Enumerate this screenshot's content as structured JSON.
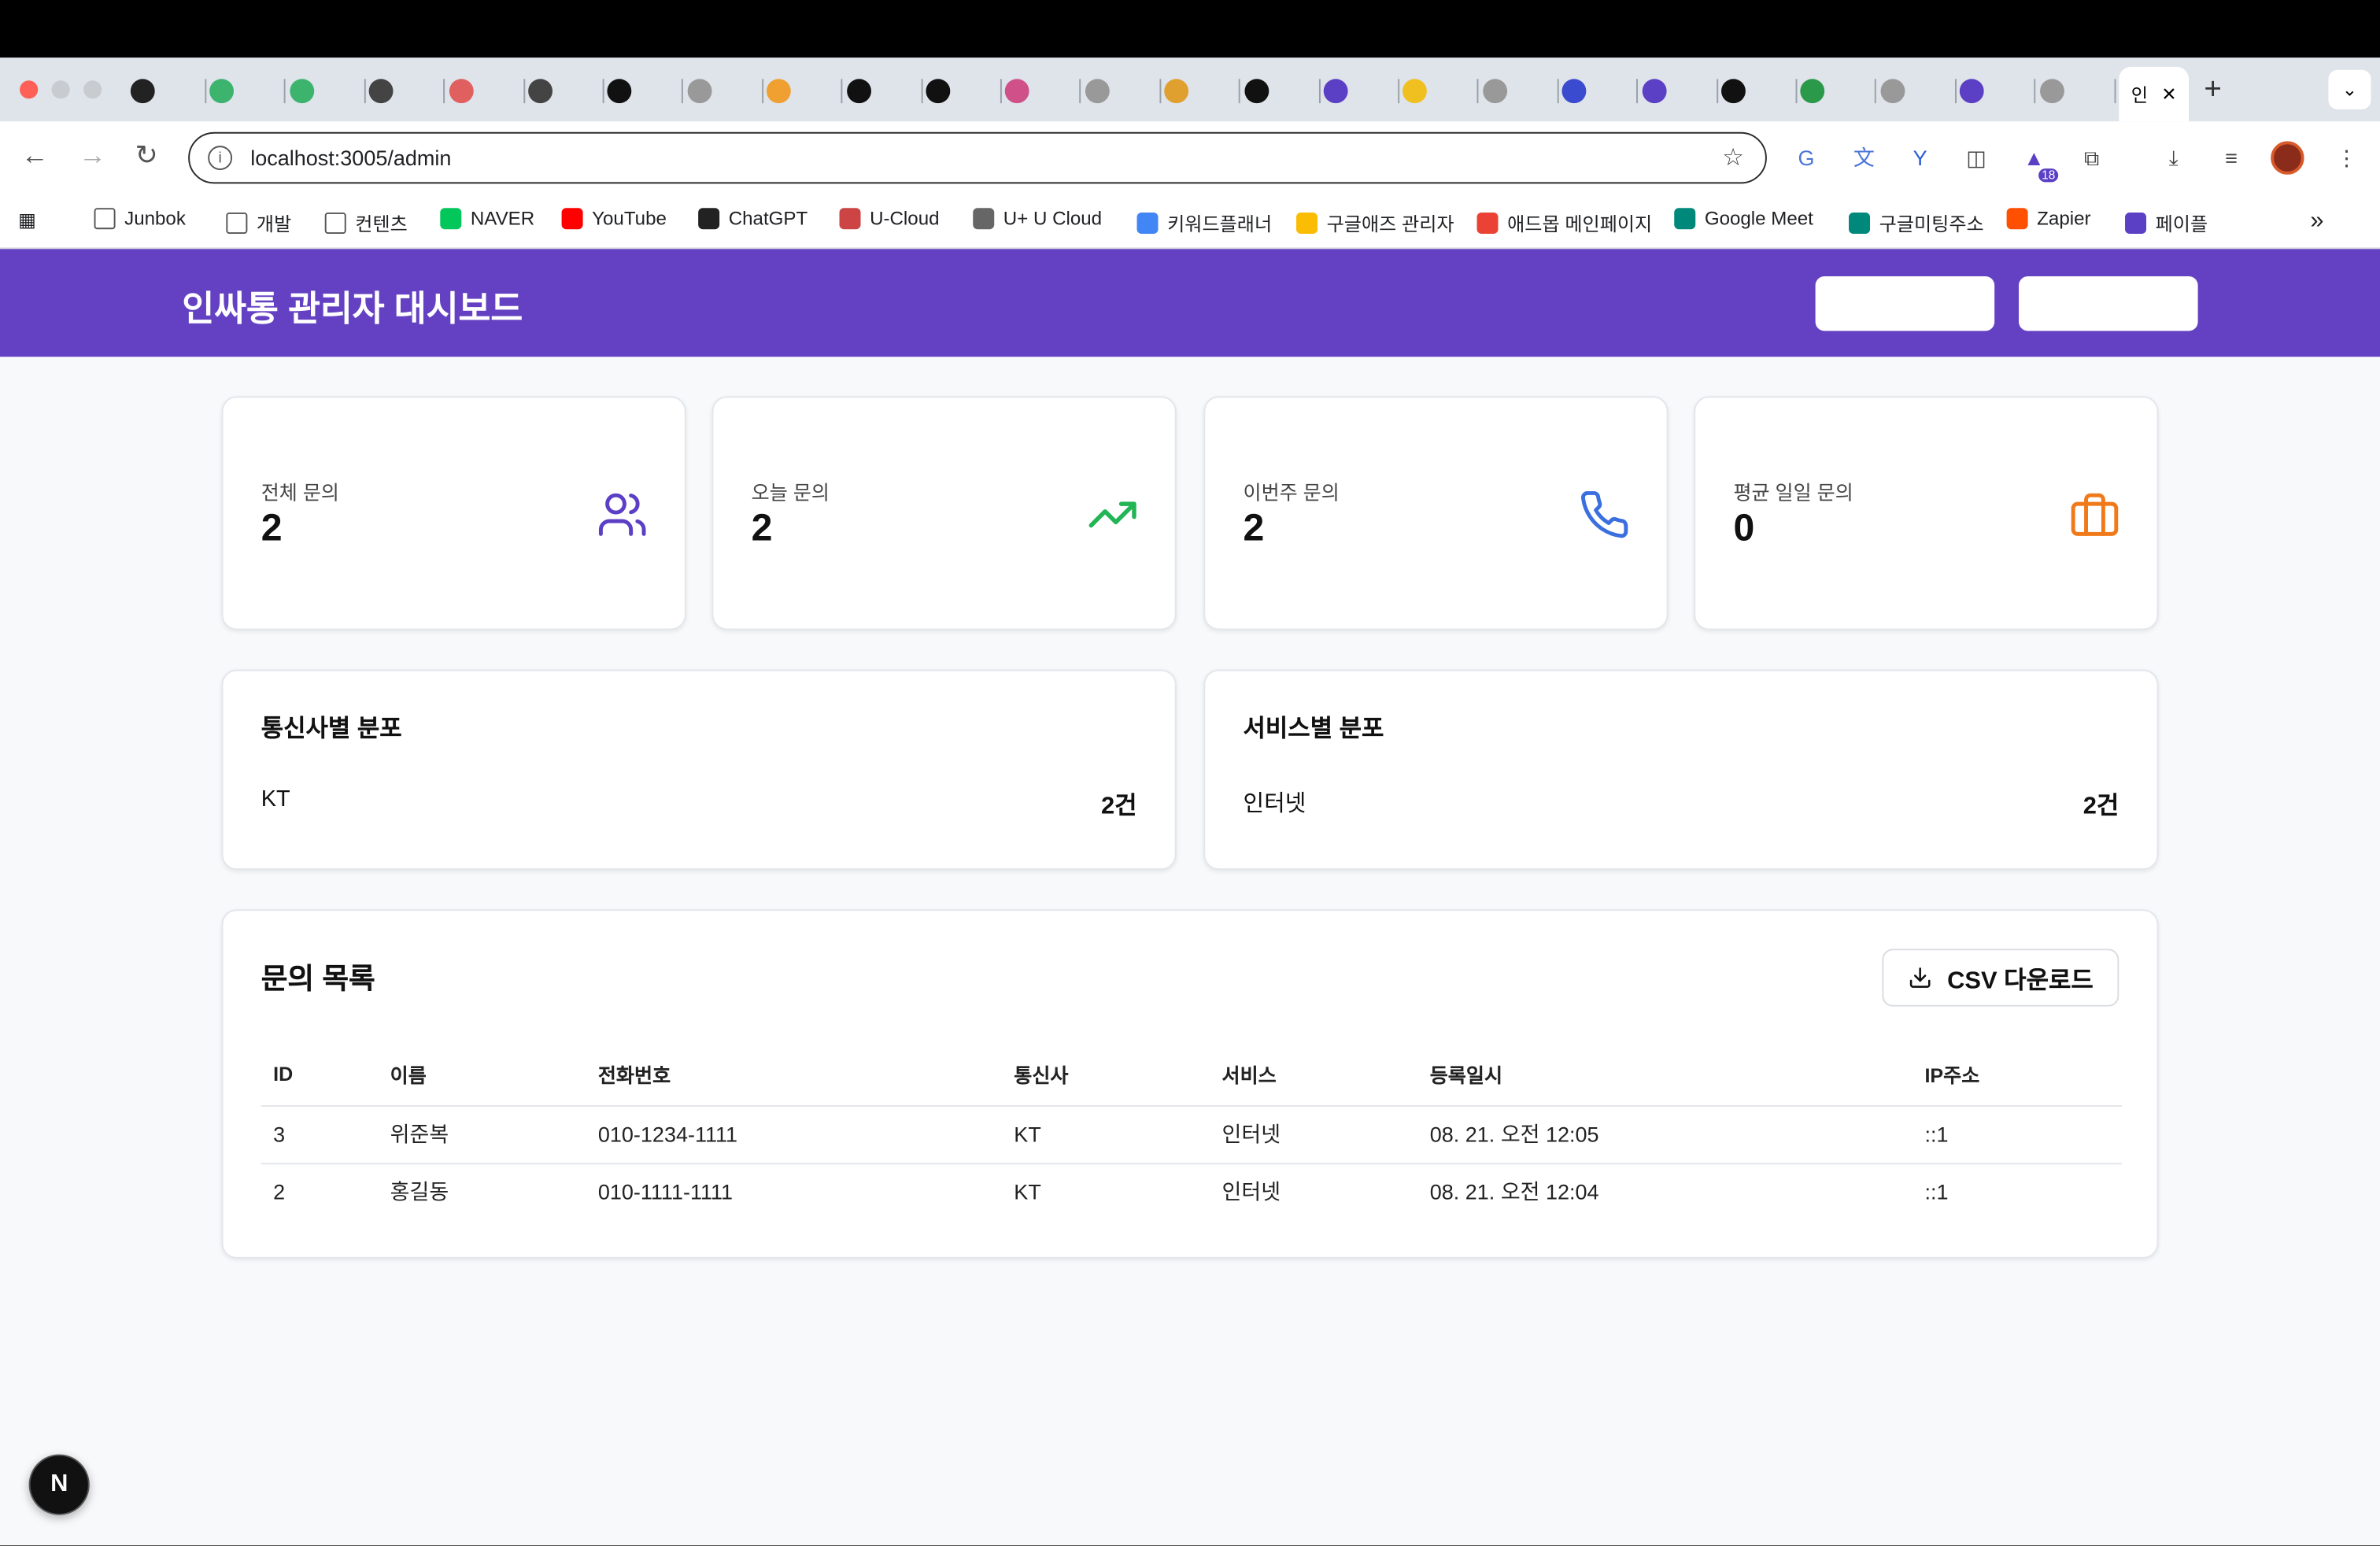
{
  "browser": {
    "url": "localhost:3005/admin",
    "active_tab_label": "인",
    "bookmarks": [
      "Junbok",
      "개발",
      "컨텐츠",
      "NAVER",
      "YouTube",
      "ChatGPT",
      "U-Cloud",
      "U+ U Cloud",
      "키워드플래너",
      "구글애즈 관리자",
      "애드몹 메인페이지",
      "Google Meet",
      "구글미팅주소",
      "Zapier",
      "페이플"
    ],
    "extension_badge": "18",
    "overflow_label": "»"
  },
  "header": {
    "title": "인싸통 관리자 대시보드"
  },
  "stats": [
    {
      "label": "전체 문의",
      "value": "2",
      "icon": "users-icon",
      "color": "#5b3fc4"
    },
    {
      "label": "오늘 문의",
      "value": "2",
      "icon": "trending-up-icon",
      "color": "#22b455"
    },
    {
      "label": "이번주 문의",
      "value": "2",
      "icon": "phone-icon",
      "color": "#3b6fe0"
    },
    {
      "label": "평균 일일 문의",
      "value": "0",
      "icon": "briefcase-icon",
      "color": "#f07a1a"
    }
  ],
  "carrier_dist": {
    "title": "통신사별 분포",
    "name": "KT",
    "count": "2건"
  },
  "service_dist": {
    "title": "서비스별 분포",
    "name": "인터넷",
    "count": "2건"
  },
  "inquiries": {
    "title": "문의 목록",
    "csv_label": "CSV 다운로드",
    "columns": [
      "ID",
      "이름",
      "전화번호",
      "통신사",
      "서비스",
      "등록일시",
      "IP주소"
    ],
    "rows": [
      [
        "3",
        "위준복",
        "010-1234-1111",
        "KT",
        "인터넷",
        "08. 21. 오전 12:05",
        "::1"
      ],
      [
        "2",
        "홍길동",
        "010-1111-1111",
        "KT",
        "인터넷",
        "08. 21. 오전 12:04",
        "::1"
      ]
    ]
  },
  "dev_badge": "N"
}
